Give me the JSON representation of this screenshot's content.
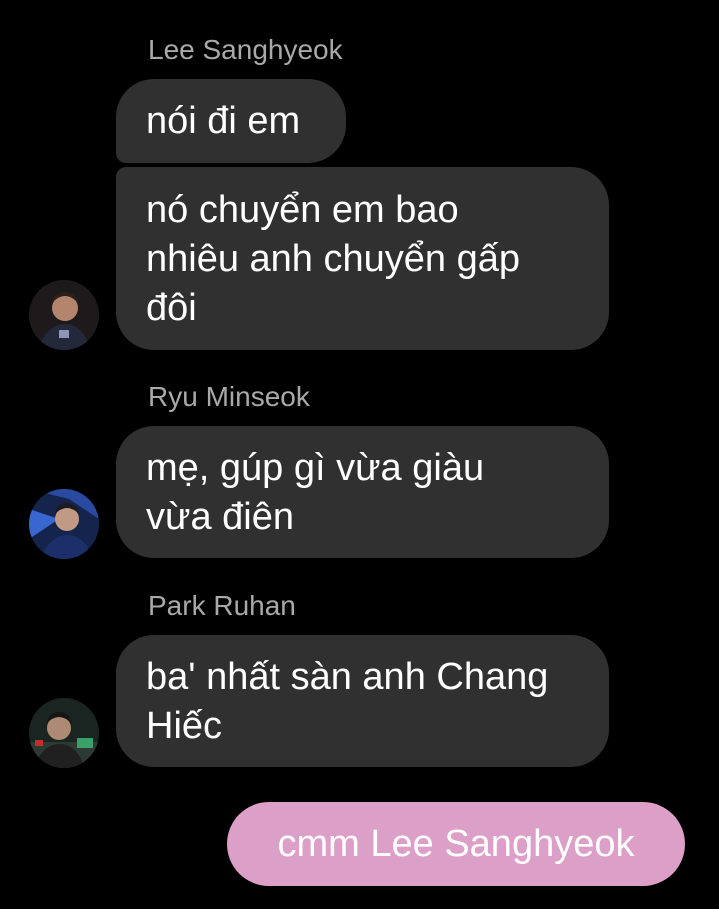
{
  "conversation": {
    "groups": [
      {
        "sender": "Lee Sanghyeok",
        "messages": [
          "nói đi em",
          "nó chuyển em bao\nnhiêu anh chuyển gấp\nđôi"
        ]
      },
      {
        "sender": "Ryu Minseok",
        "messages": [
          "mẹ, gúp gì vừa giàu\nvừa điên"
        ]
      },
      {
        "sender": "Park Ruhan",
        "messages": [
          "ba' nhất sàn anh Chang\nHiếc"
        ]
      }
    ],
    "outgoing": {
      "text": "cmm Lee Sanghyeok"
    }
  },
  "theme": {
    "background": "#000000",
    "incoming_bubble": "#303030",
    "outgoing_bubble": "#dc9fc8",
    "sender_name": "#a9a9a9"
  }
}
